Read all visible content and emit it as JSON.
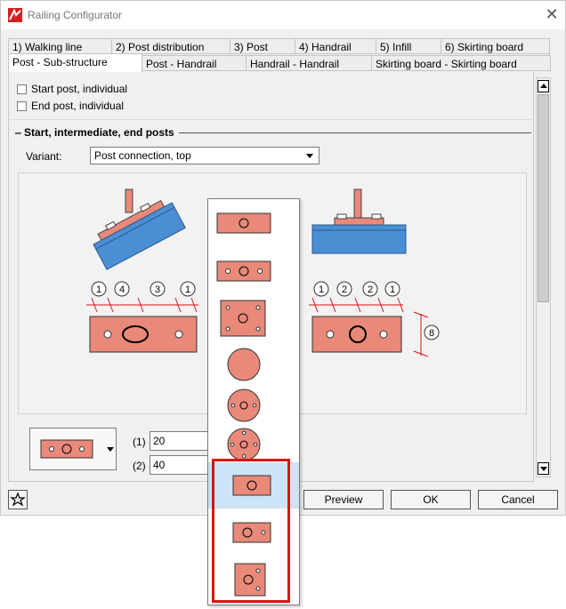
{
  "window": {
    "title": "Railing Configurator"
  },
  "tabs_row1": [
    {
      "label": "1) Walking line"
    },
    {
      "label": "2) Post distribution"
    },
    {
      "label": "3) Post"
    },
    {
      "label": "4) Handrail"
    },
    {
      "label": "5) Infill"
    },
    {
      "label": "6) Skirting board"
    }
  ],
  "tabs_row2": [
    {
      "label": "Post - Sub-structure",
      "active": true
    },
    {
      "label": "Post - Handrail"
    },
    {
      "label": "Handrail - Handrail"
    },
    {
      "label": "Skirting board - Skirting board"
    }
  ],
  "options": {
    "start_post": "Start post, individual",
    "end_post": "End post, individual"
  },
  "section": {
    "title": "Start, intermediate, end posts"
  },
  "variant": {
    "label": "Variant:",
    "value": "Post connection, top"
  },
  "drawing": {
    "left_dims": [
      "1",
      "4",
      "3",
      "1"
    ],
    "right_dims": [
      "1",
      "2",
      "2",
      "1"
    ],
    "height_dim": "8"
  },
  "fields": [
    {
      "label": "(1)",
      "value": "20"
    },
    {
      "label": "(2)",
      "value": "40"
    }
  ],
  "buttons": {
    "preview": "Preview",
    "ok": "OK",
    "cancel": "Cancel"
  },
  "colors": {
    "plate": "#e8897a",
    "beam": "#4a8fd4",
    "accent_red": "#e01010",
    "highlight": "#cce4f7"
  },
  "dropdown_items": [
    {
      "shape": "rect-center-hole"
    },
    {
      "shape": "rect-three-holes"
    },
    {
      "shape": "square-five-holes"
    },
    {
      "shape": "circle-plain"
    },
    {
      "shape": "circle-three-holes"
    },
    {
      "shape": "circle-five-holes"
    },
    {
      "shape": "rect-center-hole-small",
      "highlighted": true
    },
    {
      "shape": "rect-hole-side"
    },
    {
      "shape": "square-holes-offset"
    }
  ]
}
